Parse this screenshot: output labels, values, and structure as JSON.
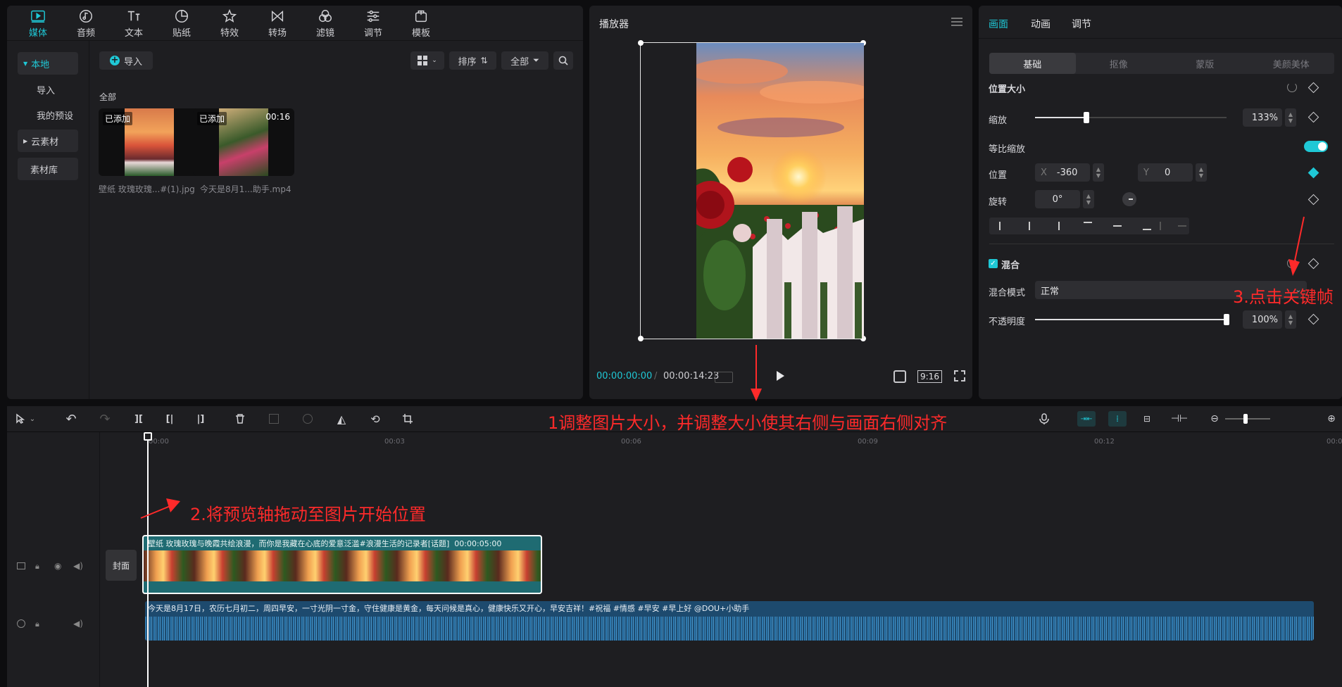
{
  "media": {
    "tabs": [
      {
        "label": "媒体",
        "icon": "media-icon"
      },
      {
        "label": "音频",
        "icon": "audio-icon"
      },
      {
        "label": "文本",
        "icon": "text-icon"
      },
      {
        "label": "贴纸",
        "icon": "sticker-icon"
      },
      {
        "label": "特效",
        "icon": "effects-icon"
      },
      {
        "label": "转场",
        "icon": "transition-icon"
      },
      {
        "label": "滤镜",
        "icon": "filter-icon"
      },
      {
        "label": "调节",
        "icon": "adjust-icon"
      },
      {
        "label": "模板",
        "icon": "template-icon"
      }
    ],
    "sidebar": [
      "本地",
      "导入",
      "我的预设",
      "云素材",
      "素材库"
    ],
    "import_label": "导入",
    "sort_label": "排序",
    "filter_label": "全部",
    "section_label": "全部",
    "items": [
      {
        "badge": "已添加",
        "duration": "",
        "name": "壁纸  玫瑰玫瑰...#(1).jpg"
      },
      {
        "badge": "已添加",
        "duration": "00:16",
        "name": "今天是8月1...助手.mp4"
      }
    ]
  },
  "player": {
    "title": "播放器",
    "current_time": "00:00:00:00",
    "total_time": "00:00:14:23",
    "ratio": "9:16"
  },
  "inspector": {
    "tabs": [
      "画面",
      "动画",
      "调节"
    ],
    "subtabs": [
      "基础",
      "抠像",
      "蒙版",
      "美颜美体"
    ],
    "section_position": "位置大小",
    "scale_label": "缩放",
    "scale_value": "133%",
    "scale_level": 0.27,
    "uniform_label": "等比缩放",
    "position_label": "位置",
    "pos_x_label": "X",
    "pos_x": "-360",
    "pos_y_label": "Y",
    "pos_y": "0",
    "rotate_label": "旋转",
    "rotate_value": "0°",
    "blend_section": "混合",
    "blend_mode_label": "混合模式",
    "blend_mode_value": "正常",
    "opacity_label": "不透明度",
    "opacity_value": "100%",
    "opacity_level": 1.0
  },
  "timeline": {
    "ruler": [
      "00:00",
      "00:03",
      "00:06",
      "00:09",
      "00:12",
      "00:0"
    ],
    "cover_label": "封面",
    "video_clip_text": "壁纸  玫瑰玫瑰与晚霞共绘浪漫，而你是我藏在心底的爱意泛滥#浪漫生活的记录者[话题]",
    "video_clip_duration": "00:00:05:00",
    "audio_clip_text": "今天是8月17日，农历七月初二，周四早安，一寸光阴一寸金，守住健康是黄金，每天问候是真心，健康快乐又开心，早安吉祥！#祝福 #情感 #早安 #早上好 @DOU+小助手"
  },
  "annotations": {
    "step1": "1调整图片大小，并调整大小使其右侧与画面右侧对齐",
    "step2": "2.将预览轴拖动至图片开始位置",
    "step3": "3.点击关键帧"
  },
  "colors": {
    "accent": "#1fc8d6",
    "annotation": "#ff2a2a",
    "video_clip": "#1f6b72",
    "audio_clip": "#1d4a6e"
  }
}
